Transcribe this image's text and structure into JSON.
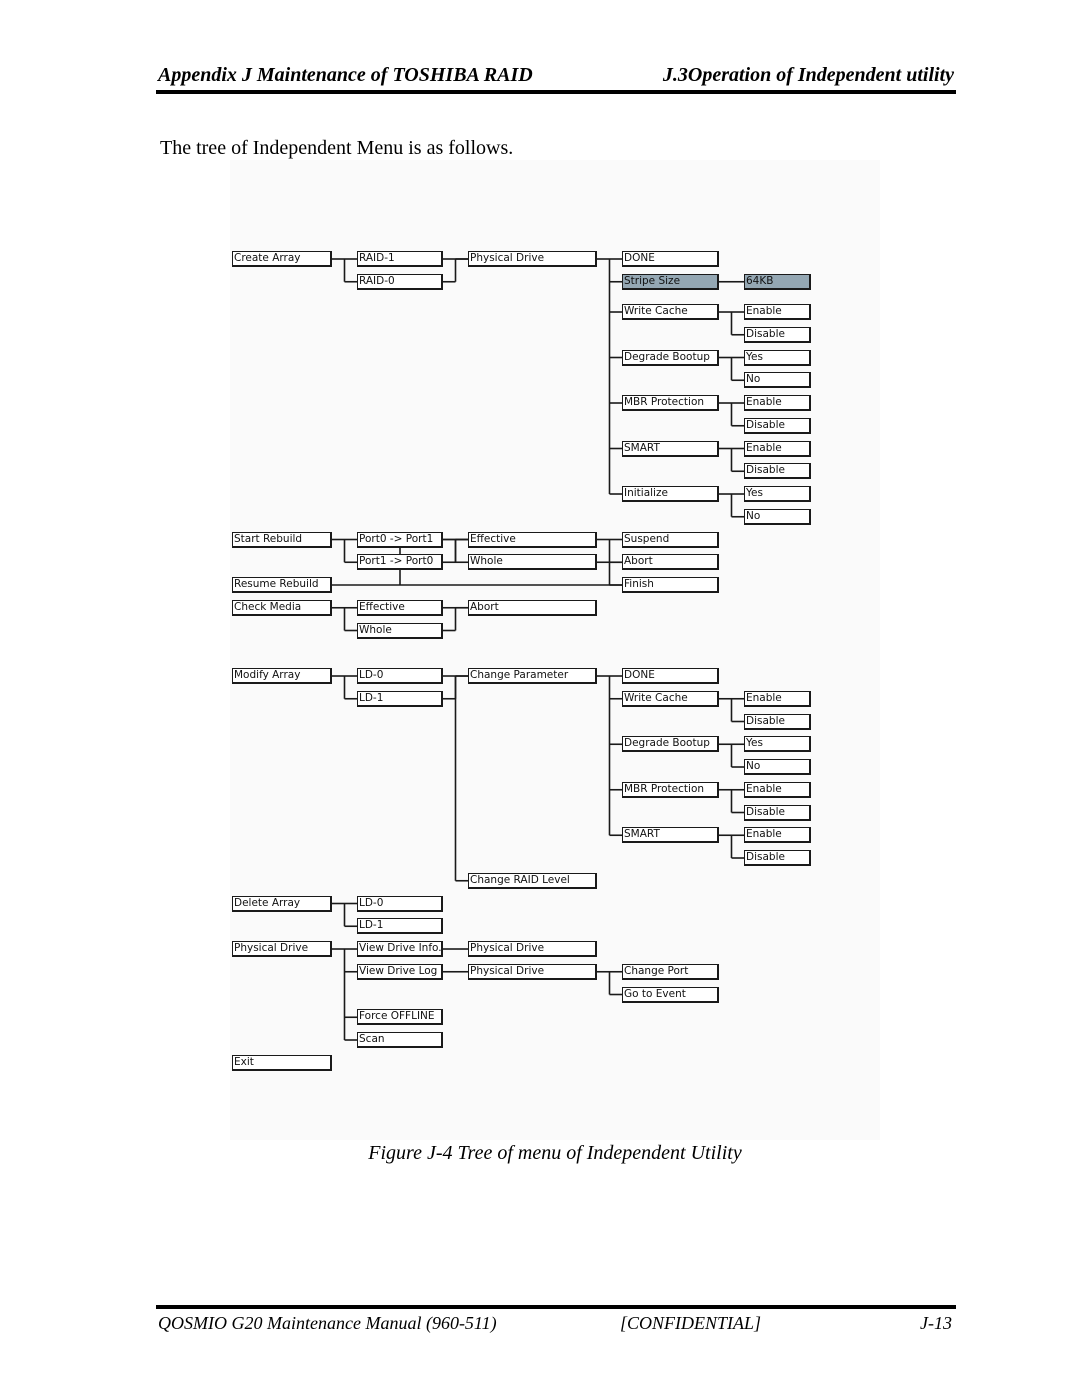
{
  "header": {
    "left": "Appendix J Maintenance of TOSHIBA RAID",
    "right": "J.3Operation of Independent utility"
  },
  "intro_text": "The tree of Independent Menu is as follows.",
  "figure_caption": "Figure J-4  Tree of menu of Independent Utility",
  "footer": {
    "left": "QOSMIO G20 Maintenance Manual (960-511)",
    "center": "[CONFIDENTIAL]",
    "right": "J-13"
  },
  "colors": {
    "highlight": "#94a7b3",
    "diagram_background": "#fafafa",
    "line": "#1a1a1a"
  },
  "nodes": [
    {
      "id": "create_array",
      "label": "Create Array",
      "col": 1,
      "row": 0
    },
    {
      "id": "raid1",
      "label": "RAID-1",
      "col": 2,
      "row": 0
    },
    {
      "id": "raid0",
      "label": "RAID-0",
      "col": 2,
      "row": 1
    },
    {
      "id": "ca_phys",
      "label": "Physical Drive",
      "col": 3,
      "row": 0
    },
    {
      "id": "ca_done",
      "label": "DONE",
      "col": 4,
      "row": 0
    },
    {
      "id": "ca_stripe",
      "label": "Stripe Size",
      "col": 4,
      "row": 1,
      "highlight": true
    },
    {
      "id": "ca_64kb",
      "label": "64KB",
      "col": 5,
      "row": 1,
      "highlight": true
    },
    {
      "id": "ca_wc",
      "label": "Write Cache",
      "col": 4,
      "row": 2.33
    },
    {
      "id": "ca_wc_en",
      "label": "Enable",
      "col": 5,
      "row": 2.33
    },
    {
      "id": "ca_wc_dis",
      "label": "Disable",
      "col": 5,
      "row": 3.33
    },
    {
      "id": "ca_db",
      "label": "Degrade Bootup",
      "col": 4,
      "row": 4.33
    },
    {
      "id": "ca_db_yes",
      "label": "Yes",
      "col": 5,
      "row": 4.33
    },
    {
      "id": "ca_db_no",
      "label": "No",
      "col": 5,
      "row": 5.33
    },
    {
      "id": "ca_mbr",
      "label": "MBR Protection",
      "col": 4,
      "row": 6.33
    },
    {
      "id": "ca_mbr_en",
      "label": "Enable",
      "col": 5,
      "row": 6.33
    },
    {
      "id": "ca_mbr_dis",
      "label": "Disable",
      "col": 5,
      "row": 7.33
    },
    {
      "id": "ca_smart",
      "label": "SMART",
      "col": 4,
      "row": 8.33
    },
    {
      "id": "ca_smart_en",
      "label": "Enable",
      "col": 5,
      "row": 8.33
    },
    {
      "id": "ca_smart_dis",
      "label": "Disable",
      "col": 5,
      "row": 9.33
    },
    {
      "id": "ca_init",
      "label": "Initialize",
      "col": 4,
      "row": 10.33
    },
    {
      "id": "ca_init_yes",
      "label": "Yes",
      "col": 5,
      "row": 10.33
    },
    {
      "id": "ca_init_no",
      "label": "No",
      "col": 5,
      "row": 11.33
    },
    {
      "id": "start_rebuild",
      "label": "Start Rebuild",
      "col": 1,
      "row": 12.33
    },
    {
      "id": "p0p1",
      "label": "Port0 -> Port1",
      "col": 2,
      "row": 12.33
    },
    {
      "id": "p1p0",
      "label": "Port1 -> Port0",
      "col": 2,
      "row": 13.33
    },
    {
      "id": "sr_eff",
      "label": "Effective",
      "col": 3,
      "row": 12.33
    },
    {
      "id": "sr_whole",
      "label": "Whole",
      "col": 3,
      "row": 13.33
    },
    {
      "id": "sr_suspend",
      "label": "Suspend",
      "col": 4,
      "row": 12.33
    },
    {
      "id": "sr_abort",
      "label": "Abort",
      "col": 4,
      "row": 13.33
    },
    {
      "id": "sr_finish",
      "label": "Finish",
      "col": 4,
      "row": 14.33
    },
    {
      "id": "resume_rebuild",
      "label": "Resume Rebuild",
      "col": 1,
      "row": 14.33
    },
    {
      "id": "check_media",
      "label": "Check Media",
      "col": 1,
      "row": 15.33
    },
    {
      "id": "cm_eff",
      "label": "Effective",
      "col": 2,
      "row": 15.33
    },
    {
      "id": "cm_whole",
      "label": "Whole",
      "col": 2,
      "row": 16.33
    },
    {
      "id": "cm_abort",
      "label": "Abort",
      "col": 3,
      "row": 15.33
    },
    {
      "id": "modify_array",
      "label": "Modify Array",
      "col": 1,
      "row": 18.33
    },
    {
      "id": "ma_ld0",
      "label": "LD-0",
      "col": 2,
      "row": 18.33
    },
    {
      "id": "ma_ld1",
      "label": "LD-1",
      "col": 2,
      "row": 19.33
    },
    {
      "id": "ma_cp",
      "label": "Change Parameter",
      "col": 3,
      "row": 18.33
    },
    {
      "id": "ma_done",
      "label": "DONE",
      "col": 4,
      "row": 18.33
    },
    {
      "id": "ma_wc",
      "label": "Write Cache",
      "col": 4,
      "row": 19.33
    },
    {
      "id": "ma_wc_en",
      "label": "Enable",
      "col": 5,
      "row": 19.33
    },
    {
      "id": "ma_wc_dis",
      "label": "Disable",
      "col": 5,
      "row": 20.33
    },
    {
      "id": "ma_db",
      "label": "Degrade Bootup",
      "col": 4,
      "row": 21.33
    },
    {
      "id": "ma_db_yes",
      "label": "Yes",
      "col": 5,
      "row": 21.33
    },
    {
      "id": "ma_db_no",
      "label": "No",
      "col": 5,
      "row": 22.33
    },
    {
      "id": "ma_mbr",
      "label": "MBR Protection",
      "col": 4,
      "row": 23.33
    },
    {
      "id": "ma_mbr_en",
      "label": "Enable",
      "col": 5,
      "row": 23.33
    },
    {
      "id": "ma_mbr_dis",
      "label": "Disable",
      "col": 5,
      "row": 24.33
    },
    {
      "id": "ma_smart",
      "label": "SMART",
      "col": 4,
      "row": 25.33
    },
    {
      "id": "ma_smart_en",
      "label": "Enable",
      "col": 5,
      "row": 25.33
    },
    {
      "id": "ma_smart_dis",
      "label": "Disable",
      "col": 5,
      "row": 26.33
    },
    {
      "id": "ma_crl",
      "label": "Change RAID Level",
      "col": 3,
      "row": 27.33
    },
    {
      "id": "delete_array",
      "label": "Delete Array",
      "col": 1,
      "row": 28.33
    },
    {
      "id": "da_ld0",
      "label": "LD-0",
      "col": 2,
      "row": 28.33
    },
    {
      "id": "da_ld1",
      "label": "LD-1",
      "col": 2,
      "row": 29.33
    },
    {
      "id": "physical_drive",
      "label": "Physical Drive",
      "col": 1,
      "row": 30.33
    },
    {
      "id": "pd_vdi",
      "label": "View Drive Info.",
      "col": 2,
      "row": 30.33
    },
    {
      "id": "pd_vdi_pd",
      "label": "Physical Drive",
      "col": 3,
      "row": 30.33
    },
    {
      "id": "pd_vdl",
      "label": "View Drive Log",
      "col": 2,
      "row": 31.33
    },
    {
      "id": "pd_vdl_pd",
      "label": "Physical Drive",
      "col": 3,
      "row": 31.33
    },
    {
      "id": "pd_cport",
      "label": "Change Port",
      "col": 4,
      "row": 31.33
    },
    {
      "id": "pd_goevent",
      "label": "Go to Event",
      "col": 4,
      "row": 32.33
    },
    {
      "id": "pd_force",
      "label": "Force OFFLINE",
      "col": 2,
      "row": 33.33
    },
    {
      "id": "pd_scan",
      "label": "Scan",
      "col": 2,
      "row": 34.33
    },
    {
      "id": "exit",
      "label": "Exit",
      "col": 1,
      "row": 35.33
    }
  ],
  "edges": [
    [
      "create_array",
      "raid1"
    ],
    [
      "create_array",
      "raid0"
    ],
    [
      "raid1",
      "ca_phys"
    ],
    [
      "raid0",
      "ca_phys"
    ],
    [
      "ca_phys",
      "ca_done"
    ],
    [
      "ca_phys",
      "ca_stripe"
    ],
    [
      "ca_phys",
      "ca_wc"
    ],
    [
      "ca_phys",
      "ca_db"
    ],
    [
      "ca_phys",
      "ca_mbr"
    ],
    [
      "ca_phys",
      "ca_smart"
    ],
    [
      "ca_phys",
      "ca_init"
    ],
    [
      "ca_stripe",
      "ca_64kb"
    ],
    [
      "ca_wc",
      "ca_wc_en"
    ],
    [
      "ca_wc",
      "ca_wc_dis"
    ],
    [
      "ca_db",
      "ca_db_yes"
    ],
    [
      "ca_db",
      "ca_db_no"
    ],
    [
      "ca_mbr",
      "ca_mbr_en"
    ],
    [
      "ca_mbr",
      "ca_mbr_dis"
    ],
    [
      "ca_smart",
      "ca_smart_en"
    ],
    [
      "ca_smart",
      "ca_smart_dis"
    ],
    [
      "ca_init",
      "ca_init_yes"
    ],
    [
      "ca_init",
      "ca_init_no"
    ],
    [
      "start_rebuild",
      "p0p1"
    ],
    [
      "start_rebuild",
      "p1p0"
    ],
    [
      "p0p1",
      "sr_eff"
    ],
    [
      "p0p1",
      "sr_whole"
    ],
    [
      "p1p0",
      "sr_eff"
    ],
    [
      "resume_rebuild",
      "sr_eff"
    ],
    [
      "sr_eff",
      "sr_suspend"
    ],
    [
      "sr_eff",
      "sr_abort"
    ],
    [
      "sr_eff",
      "sr_finish"
    ],
    [
      "sr_whole",
      "sr_abort"
    ],
    [
      "resume_rebuild",
      "sr_finish"
    ],
    [
      "check_media",
      "cm_eff"
    ],
    [
      "check_media",
      "cm_whole"
    ],
    [
      "cm_eff",
      "cm_abort"
    ],
    [
      "cm_whole",
      "cm_abort"
    ],
    [
      "modify_array",
      "ma_ld0"
    ],
    [
      "modify_array",
      "ma_ld1"
    ],
    [
      "ma_ld0",
      "ma_cp"
    ],
    [
      "ma_ld1",
      "ma_cp"
    ],
    [
      "ma_ld0",
      "ma_crl"
    ],
    [
      "ma_cp",
      "ma_done"
    ],
    [
      "ma_cp",
      "ma_wc"
    ],
    [
      "ma_cp",
      "ma_db"
    ],
    [
      "ma_cp",
      "ma_mbr"
    ],
    [
      "ma_cp",
      "ma_smart"
    ],
    [
      "ma_wc",
      "ma_wc_en"
    ],
    [
      "ma_wc",
      "ma_wc_dis"
    ],
    [
      "ma_db",
      "ma_db_yes"
    ],
    [
      "ma_db",
      "ma_db_no"
    ],
    [
      "ma_mbr",
      "ma_mbr_en"
    ],
    [
      "ma_mbr",
      "ma_mbr_dis"
    ],
    [
      "ma_smart",
      "ma_smart_en"
    ],
    [
      "ma_smart",
      "ma_smart_dis"
    ],
    [
      "delete_array",
      "da_ld0"
    ],
    [
      "delete_array",
      "da_ld1"
    ],
    [
      "physical_drive",
      "pd_vdi"
    ],
    [
      "physical_drive",
      "pd_vdl"
    ],
    [
      "physical_drive",
      "pd_force"
    ],
    [
      "physical_drive",
      "pd_scan"
    ],
    [
      "pd_vdi",
      "pd_vdi_pd"
    ],
    [
      "pd_vdl",
      "pd_vdl_pd"
    ],
    [
      "pd_vdl_pd",
      "pd_cport"
    ],
    [
      "pd_vdl_pd",
      "pd_goevent"
    ]
  ]
}
